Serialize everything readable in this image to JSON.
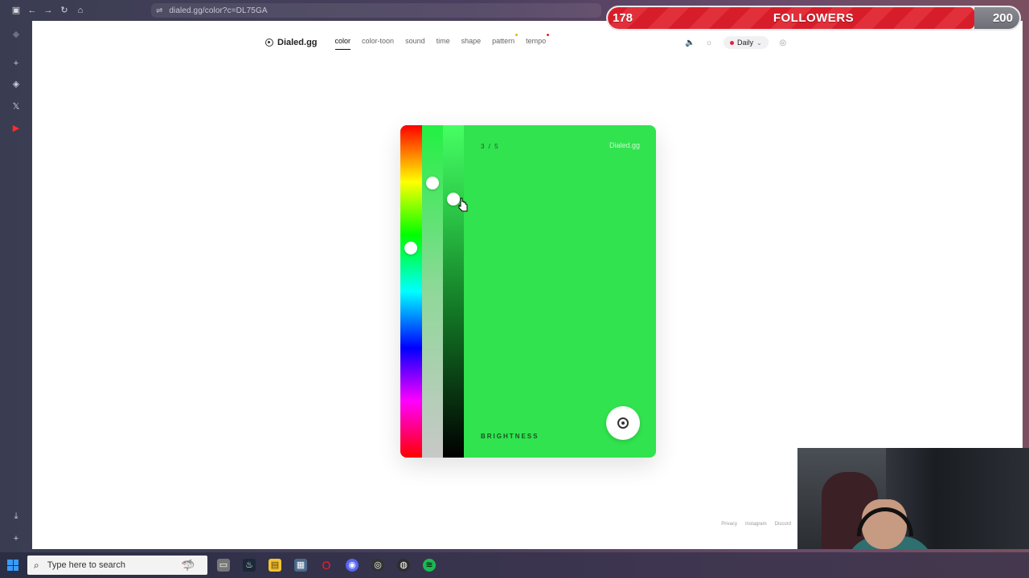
{
  "browser": {
    "url": "dialed.gg/color?c=DL75GA"
  },
  "followers": {
    "current": "178",
    "label": "FOLLOWERS",
    "goal": "200",
    "progress": 0.89
  },
  "site": {
    "logo": "Dialed.gg",
    "nav": [
      "color",
      "color-toon",
      "sound",
      "time",
      "shape",
      "pattern",
      "tempo"
    ],
    "active_nav": "color",
    "mode_label": "Daily"
  },
  "game": {
    "counter": "3 / 5",
    "brand": "Dialed.gg",
    "stage_label": "BRIGHTNESS",
    "target_color": "#31e34e",
    "hue_level": 0.37,
    "saturation_level": 0.17,
    "brightness_level": 0.22
  },
  "footer": {
    "links": [
      "Privacy",
      "Instagram",
      "Discord"
    ]
  },
  "taskbar": {
    "search_placeholder": "Type here to search"
  },
  "colors": {
    "accent_green": "#31e34e",
    "follower_red": "#d81d2a",
    "daily_dot": "#e0243a"
  }
}
